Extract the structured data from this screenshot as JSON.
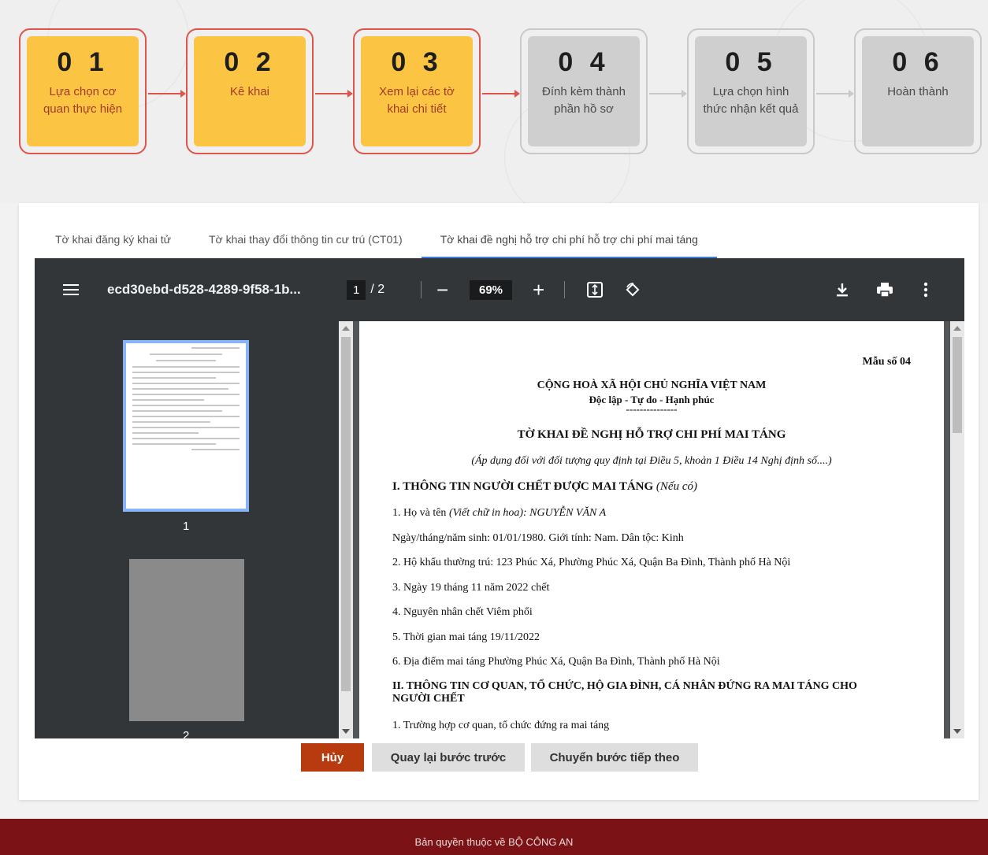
{
  "steps": [
    {
      "num": "0 1",
      "label": "Lựa chọn cơ quan thực hiện"
    },
    {
      "num": "0 2",
      "label": "Kê khai"
    },
    {
      "num": "0 3",
      "label": "Xem lại các tờ khai chi tiết"
    },
    {
      "num": "0 4",
      "label": "Đính kèm thành phần hồ sơ"
    },
    {
      "num": "0 5",
      "label": "Lựa chọn hình thức nhận kết quả"
    },
    {
      "num": "0 6",
      "label": "Hoàn thành"
    }
  ],
  "colors": {
    "done_step": "#fbc442",
    "todo_step": "#cfcfcf",
    "accent_red": "#e0544a",
    "cancel": "#b83b10",
    "footer": "#7b1316",
    "tab_active": "#3b7dd8"
  },
  "tabs": [
    {
      "label": "Tờ khai đăng ký khai tử"
    },
    {
      "label": "Tờ khai thay đổi thông tin cư trú (CT01)"
    },
    {
      "label": "Tờ khai đề nghị hỗ trợ chi phí hỗ trợ chi phí mai táng"
    }
  ],
  "viewer": {
    "file_name": "ecd30ebd-d528-4289-9f58-1b...",
    "current_page": "1",
    "total_pages": "/ 2",
    "zoom": "69%",
    "thumb_labels": [
      "1",
      "2"
    ],
    "icons": [
      "menu-icon",
      "zoom-out-icon",
      "zoom-in-icon",
      "fit-page-icon",
      "rotate-icon",
      "download-icon",
      "print-icon",
      "more-icon"
    ]
  },
  "document": {
    "form_no": "Mẫu số 04",
    "nation": "CỘNG HOÀ XÃ HỘI CHỦ NGHĨA VIỆT NAM",
    "motto": "Độc lập - Tự do - Hạnh phúc",
    "rule": "---------------",
    "title": "TỜ KHAI ĐỀ NGHỊ HỖ TRỢ CHI PHÍ MAI TÁNG",
    "subtitle": "(Áp dụng đối với đối tượng quy định tại Điều 5, khoản 1 Điều 14 Nghị định số....)",
    "section1_title": "I. THÔNG TIN NGƯỜI CHẾT ĐƯỢC MAI TÁNG",
    "section1_note": "(Nếu có)",
    "line1_prefix": "1. Họ và tên",
    "line1_value": "(Viết chữ in hoa): NGUYỄN VĂN A",
    "line2": "Ngày/tháng/năm sinh: 01/01/1980. Giới tính: Nam. Dân tộc: Kinh",
    "line3": "2. Hộ khẩu thường trú:  123 Phúc Xá, Phường Phúc Xá, Quận Ba Đình, Thành phố Hà Nội",
    "line4": "3. Ngày 19 tháng 11 năm 2022 chết",
    "line5": "4. Nguyên nhân chết Viêm phổi",
    "line6": "5. Thời gian mai táng 19/11/2022",
    "line7": "6. Địa điểm mai táng Phường Phúc Xá, Quận Ba Đình, Thành phố Hà Nội",
    "section2_title_a": "II. THÔNG TIN CƠ QUAN, TỔ CHỨC, HỘ GIA ĐÌNH, CÁ NHÂN ĐỨNG RA MAI TÁNG CHO",
    "section2_title_b": "NGƯỜI CHẾT",
    "line8": "1. Trường hợp cơ quan, tổ chức đứng ra mai táng"
  },
  "buttons": {
    "cancel": "Hủy",
    "back": "Quay lại bước trước",
    "next": "Chuyển bước tiếp theo"
  },
  "footer": {
    "text": "Bản quyền thuộc về BỘ CÔNG AN"
  }
}
